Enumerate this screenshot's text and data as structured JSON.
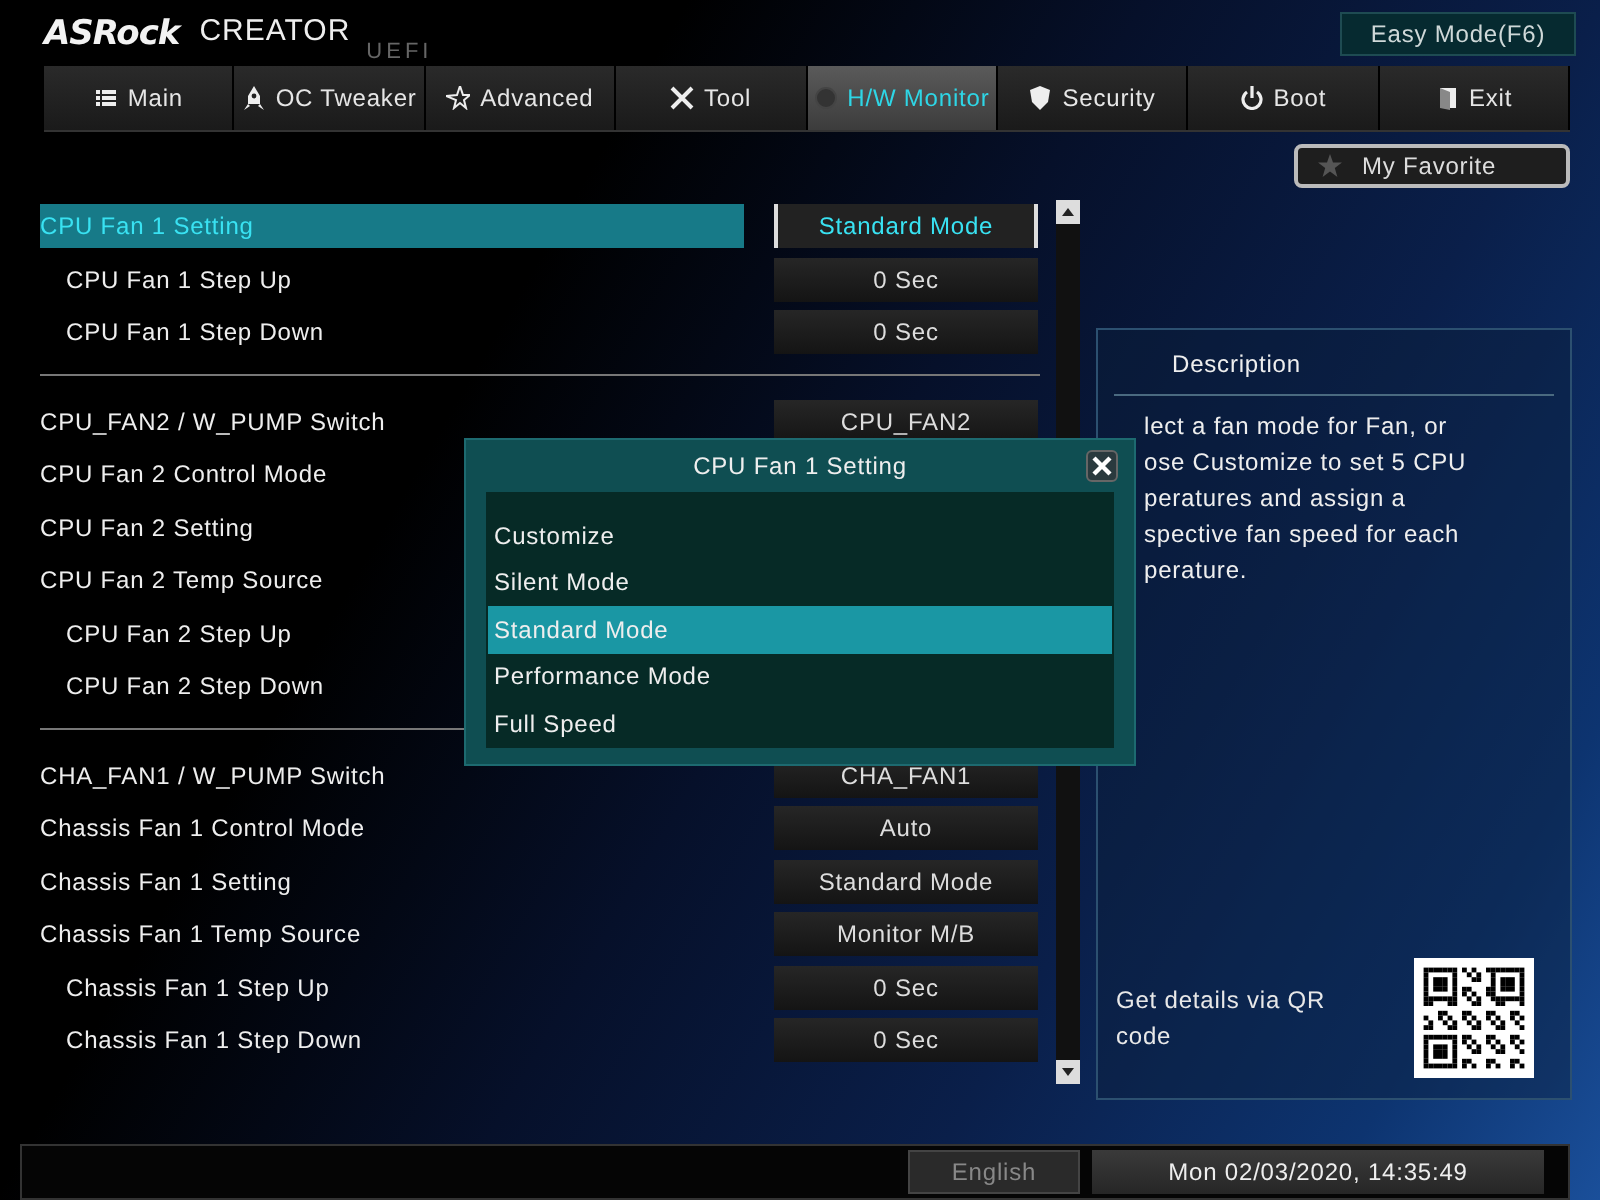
{
  "header": {
    "brand": "ASRock",
    "product": "CREATOR",
    "edition": "UEFI",
    "mode_button": "Easy Mode(F6)"
  },
  "tabs": [
    {
      "label": "Main",
      "selected": false
    },
    {
      "label": "OC Tweaker",
      "selected": false
    },
    {
      "label": "Advanced",
      "selected": false
    },
    {
      "label": "Tool",
      "selected": false
    },
    {
      "label": "H/W Monitor",
      "selected": true
    },
    {
      "label": "Security",
      "selected": false
    },
    {
      "label": "Boot",
      "selected": false
    },
    {
      "label": "Exit",
      "selected": false
    }
  ],
  "favorite_button": "My Favorite",
  "settings": [
    {
      "rows": [
        {
          "label": "CPU Fan 1 Setting",
          "value": "Standard Mode",
          "sub": false,
          "selected": true
        },
        {
          "label": "CPU Fan 1 Step Up",
          "value": "0 Sec",
          "sub": true,
          "selected": false
        },
        {
          "label": "CPU Fan 1 Step Down",
          "value": "0 Sec",
          "sub": true,
          "selected": false
        }
      ]
    },
    {
      "rows": [
        {
          "label": "CPU_FAN2 / W_PUMP Switch",
          "value": "CPU_FAN2",
          "sub": false,
          "selected": false
        },
        {
          "label": "CPU Fan 2 Control Mode",
          "sub": false,
          "selected": false
        },
        {
          "label": "CPU Fan 2 Setting",
          "sub": false,
          "selected": false
        },
        {
          "label": "CPU Fan 2 Temp Source",
          "sub": false,
          "selected": false
        },
        {
          "label": "CPU Fan 2 Step Up",
          "sub": true,
          "selected": false
        },
        {
          "label": "CPU Fan 2 Step Down",
          "sub": true,
          "selected": false
        }
      ]
    },
    {
      "rows": [
        {
          "label": "CHA_FAN1 / W_PUMP Switch",
          "value": "CHA_FAN1",
          "sub": false,
          "selected": false
        },
        {
          "label": "Chassis Fan 1 Control Mode",
          "value": "Auto",
          "sub": false,
          "selected": false
        },
        {
          "label": "Chassis Fan 1 Setting",
          "value": "Standard Mode",
          "sub": false,
          "selected": false
        },
        {
          "label": "Chassis Fan 1 Temp Source",
          "value": "Monitor M/B",
          "sub": false,
          "selected": false
        },
        {
          "label": "Chassis Fan 1 Step Up",
          "value": "0 Sec",
          "sub": true,
          "selected": false
        },
        {
          "label": "Chassis Fan 1 Step Down",
          "value": "0 Sec",
          "sub": true,
          "selected": false
        }
      ]
    }
  ],
  "description": {
    "title": "Description",
    "lines": [
      "lect a fan mode for Fan, or",
      "ose Customize to set 5 CPU",
      "peratures and assign a",
      "spective fan speed for each",
      "perature."
    ],
    "qr_text": "Get details via QR code"
  },
  "status_bar": {
    "language": "English",
    "datetime": "Mon 02/03/2020, 14:35:49"
  },
  "popup": {
    "title": "CPU Fan 1 Setting",
    "options": [
      {
        "label": "Customize",
        "selected": false
      },
      {
        "label": "Silent Mode",
        "selected": false
      },
      {
        "label": "Standard Mode",
        "selected": true
      },
      {
        "label": "Performance Mode",
        "selected": false
      },
      {
        "label": "Full Speed",
        "selected": false
      }
    ]
  }
}
